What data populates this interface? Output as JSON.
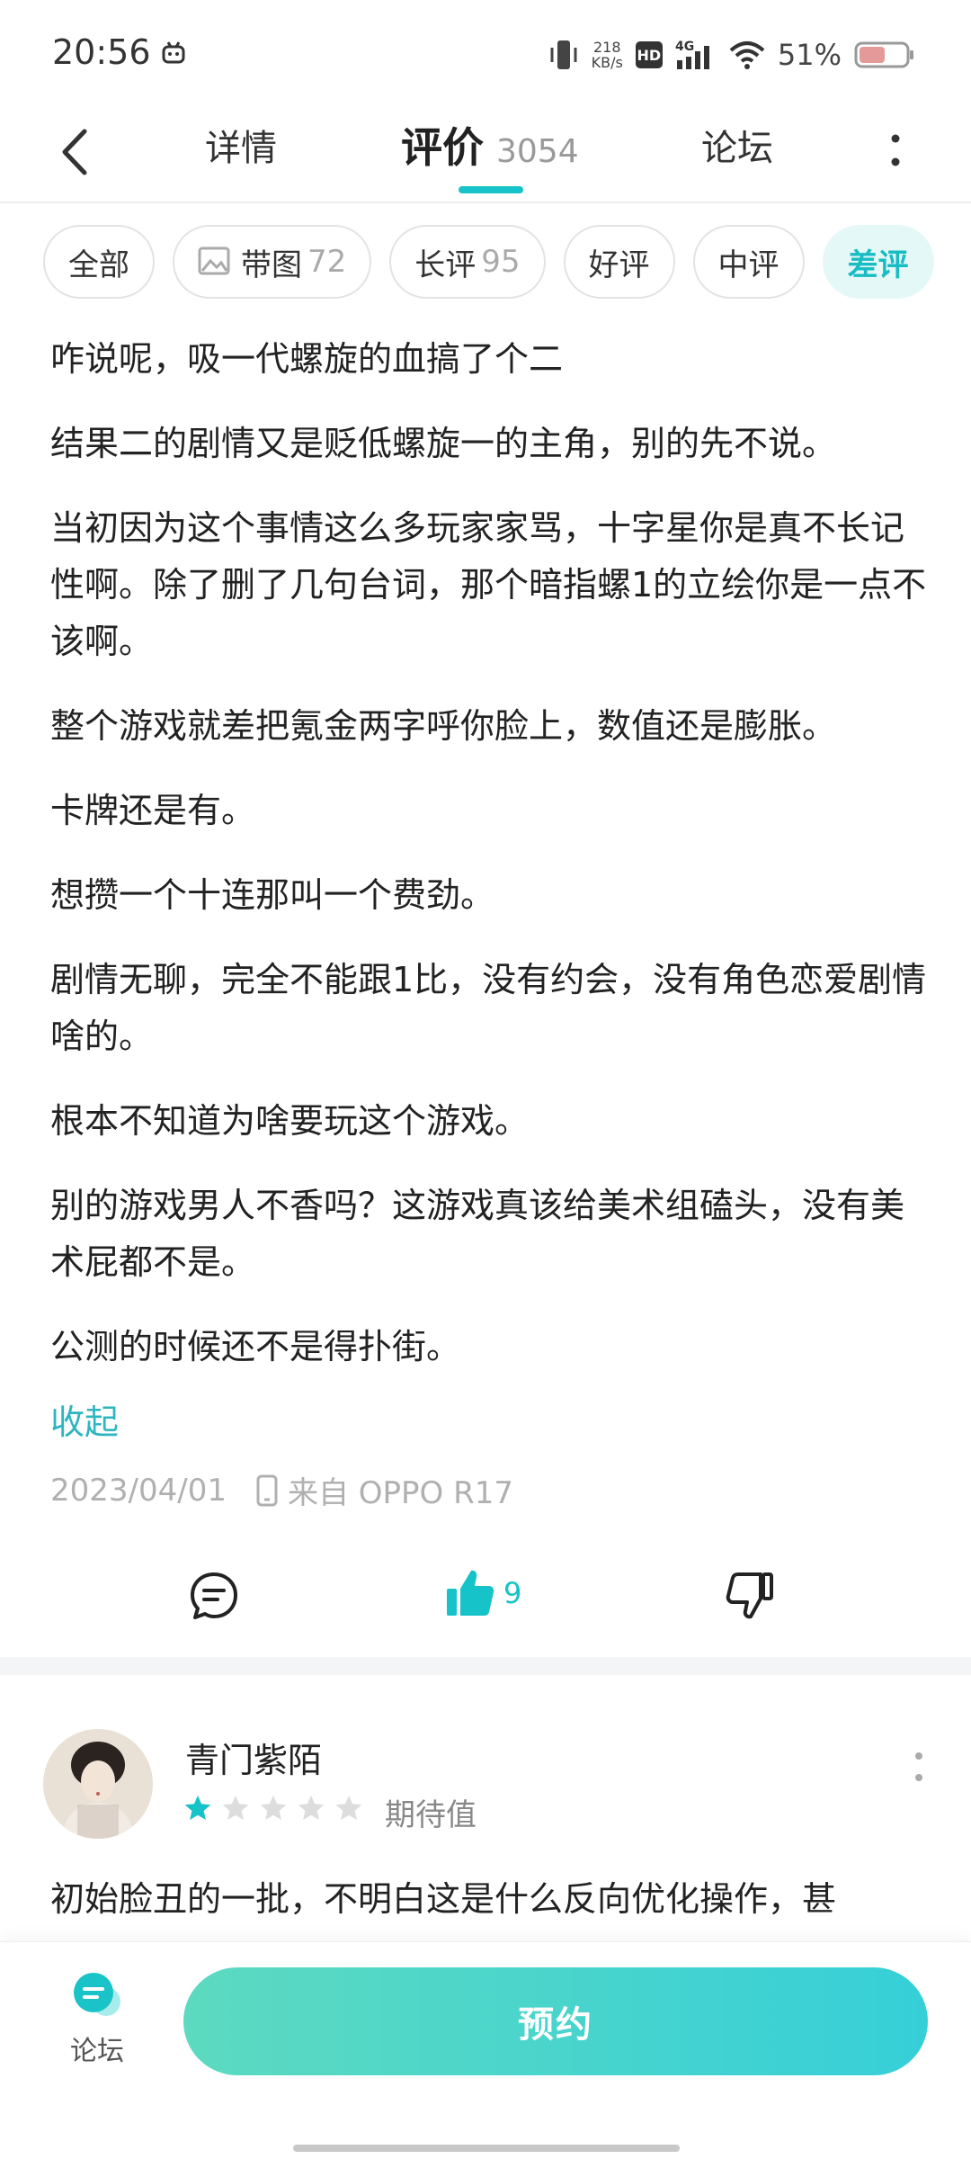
{
  "status_bar": {
    "time": "20:56",
    "net_speed_value": "218",
    "net_speed_unit": "KB/s",
    "hd_label": "HD",
    "network_type": "4G",
    "battery_percent": "51%"
  },
  "top_nav": {
    "tabs": [
      {
        "label": "详情"
      },
      {
        "label": "评价",
        "count": "3054",
        "active": true
      },
      {
        "label": "论坛"
      }
    ],
    "accent_color": "#16c3c8"
  },
  "filters": [
    {
      "label": "全部"
    },
    {
      "label": "带图",
      "count": "72",
      "icon": "image-icon"
    },
    {
      "label": "长评",
      "count": "95"
    },
    {
      "label": "好评"
    },
    {
      "label": "中评"
    },
    {
      "label": "差评",
      "active": true
    }
  ],
  "review": {
    "paragraphs": [
      "咋说呢，吸一代螺旋的血搞了个二",
      "结果二的剧情又是贬低螺旋一的主角，别的先不说。",
      "当初因为这个事情这么多玩家家骂，十字星你是真不长记性啊。除了删了几句台词，那个暗指螺1的立绘你是一点不该啊。",
      "整个游戏就差把氪金两字呼你脸上，数值还是膨胀。",
      "卡牌还是有。",
      "想攒一个十连那叫一个费劲。",
      "剧情无聊，完全不能跟1比，没有约会，没有角色恋爱剧情啥的。",
      "根本不知道为啥要玩这个游戏。",
      "别的游戏男人不香吗？这游戏真该给美术组磕头，没有美术屁都不是。",
      "公测的时候还不是得扑街。"
    ],
    "collapse_label": "收起",
    "date": "2023/04/01",
    "device": "来自 OPPO R17",
    "like_count": "9"
  },
  "review2": {
    "username": "青门紫陌",
    "rating_stars": 1,
    "rating_max": 5,
    "rating_label": "期待值",
    "text_preview": "初始脸丑的一批，不明白这是什么反向优化操作，甚"
  },
  "bottom_bar": {
    "forum_label": "论坛",
    "reserve_label": "预约"
  }
}
